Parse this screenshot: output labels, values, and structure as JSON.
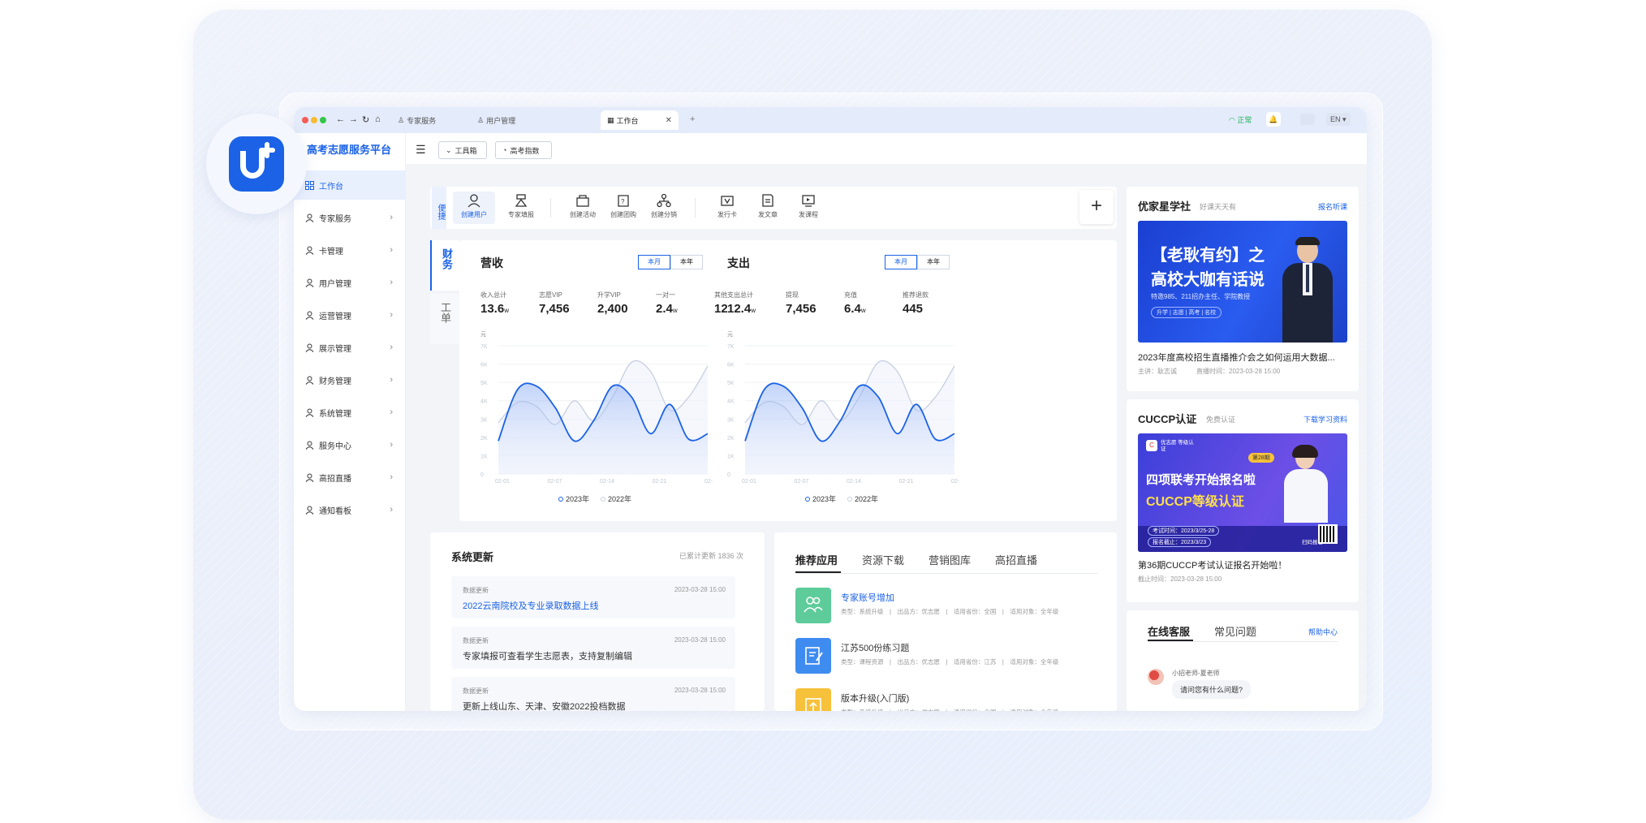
{
  "browser": {
    "tabs": [
      "专家服务",
      "用户管理",
      "工作台"
    ],
    "new_tab": "+",
    "status": "正常",
    "lang": "EN"
  },
  "sidebar": {
    "brand": "高考志愿服务平台",
    "items": [
      {
        "label": "工作台",
        "icon": "grid-icon"
      },
      {
        "label": "专家服务",
        "icon": "user-icon"
      },
      {
        "label": "卡管理",
        "icon": "user-icon"
      },
      {
        "label": "用户管理",
        "icon": "user-icon"
      },
      {
        "label": "运营管理",
        "icon": "user-icon"
      },
      {
        "label": "展示管理",
        "icon": "user-icon"
      },
      {
        "label": "财务管理",
        "icon": "user-icon"
      },
      {
        "label": "系统管理",
        "icon": "user-icon"
      },
      {
        "label": "服务中心",
        "icon": "user-icon"
      },
      {
        "label": "高招直播",
        "icon": "user-icon"
      },
      {
        "label": "通知看板",
        "icon": "user-icon"
      }
    ]
  },
  "topbar": {
    "toolbox": "工具箱",
    "gaokao_index": "高考指数"
  },
  "quick": {
    "label": "便捷",
    "items": [
      "创建用户",
      "专家填报",
      "创建活动",
      "创建团购",
      "创建分销",
      "发行卡",
      "发文章",
      "发课程"
    ]
  },
  "finance_tabs": [
    "财务",
    "工单"
  ],
  "revenue": {
    "title": "营收",
    "seg_month": "本月",
    "seg_year": "本年",
    "stats": [
      {
        "label": "收入总计",
        "value": "13.6",
        "unit": "w"
      },
      {
        "label": "志愿VIP",
        "value": "7,456",
        "unit": ""
      },
      {
        "label": "升学VIP",
        "value": "2,400",
        "unit": ""
      },
      {
        "label": "一对一",
        "value": "2.4",
        "unit": "w"
      },
      {
        "label": "其他",
        "value": "12",
        "unit": ""
      }
    ]
  },
  "expense": {
    "title": "支出",
    "seg_month": "本月",
    "seg_year": "本年",
    "stats": [
      {
        "label": "支出总计",
        "value": "12.4",
        "unit": "w"
      },
      {
        "label": "提现",
        "value": "7,456",
        "unit": ""
      },
      {
        "label": "充值",
        "value": "6.4",
        "unit": "w"
      },
      {
        "label": "推荐退款",
        "value": "445",
        "unit": ""
      }
    ]
  },
  "chart_data": [
    {
      "type": "line",
      "ylabel": "元",
      "yticks": [
        "7K",
        "6K",
        "5K",
        "4K",
        "3K",
        "2K",
        "1K",
        "0"
      ],
      "ylim": [
        0,
        7000
      ],
      "xticks": [
        "02-01",
        "02-07",
        "02-14",
        "02-21",
        "02-28"
      ],
      "series": [
        {
          "name": "2023年",
          "values": [
            1800,
            4600,
            4800,
            3600,
            1800,
            2900,
            4800,
            4200,
            2200,
            3800,
            1900,
            2200
          ]
        },
        {
          "name": "2022年",
          "values": [
            2800,
            3900,
            3700,
            2700,
            4000,
            2900,
            4200,
            6100,
            5600,
            3500,
            4200,
            5900
          ]
        }
      ],
      "grid": true
    },
    {
      "type": "line",
      "ylabel": "元",
      "yticks": [
        "7K",
        "6K",
        "5K",
        "4K",
        "3K",
        "2K",
        "1K",
        "0"
      ],
      "ylim": [
        0,
        7000
      ],
      "xticks": [
        "02-01",
        "02-07",
        "02-14",
        "02-21",
        "02-28"
      ],
      "series": [
        {
          "name": "2023年",
          "values": [
            1800,
            4600,
            4800,
            3600,
            1800,
            2900,
            4800,
            4200,
            2200,
            3800,
            1900,
            2200
          ]
        },
        {
          "name": "2022年",
          "values": [
            2800,
            3900,
            3700,
            2700,
            4000,
            2900,
            4200,
            6100,
            5600,
            3500,
            4200,
            5900
          ]
        }
      ],
      "grid": true
    }
  ],
  "updates": {
    "title": "系统更新",
    "count_text": "已累计更新 1836 次",
    "items": [
      {
        "category": "数据更新",
        "date": "2023-03-28 15:00",
        "title": "2022云南院校及专业录取数据上线",
        "highlight": true
      },
      {
        "category": "数据更新",
        "date": "2023-03-28 15:00",
        "title": "专家填报可查看学生志愿表，支持复制编辑",
        "highlight": false
      },
      {
        "category": "数据更新",
        "date": "2023-03-28 15:00",
        "title": "更新上线山东、天津、安徽2022投档数据",
        "highlight": false
      }
    ]
  },
  "apps": {
    "tabs": [
      "推荐应用",
      "资源下载",
      "营销图库",
      "高招直播"
    ],
    "items": [
      {
        "title": "专家账号增加",
        "meta": "类型：系统升级　|　出品方：优志愿　|　适用省份：全国　|　适用对象：全年级",
        "color": "#5dcc9a",
        "highlight": true
      },
      {
        "title": "江苏500份练习题",
        "meta": "类型：课程资源　|　出品方：优志愿　|　适用省份：江苏　|　适用对象：全年级",
        "color": "#3f8cf0",
        "highlight": false
      },
      {
        "title": "版本升级(入门版)",
        "meta": "类型：系统升级　|　出品方：优志愿　|　适用省份：全国　|　适用对象：全年级",
        "color": "#f7c23b",
        "highlight": false
      }
    ]
  },
  "promo1": {
    "title": "优家星学社",
    "sub": "好课天天有",
    "link": "报名听课",
    "banner_line1": "【老耿有约】之",
    "banner_line2": "高校大咖有话说",
    "banner_line3": "特邀985、211招办主任、学院教授",
    "banner_tags": "升学 | 志愿 | 高考 | 名校",
    "caption": "2023年度高校招生直播推介会之如何运用大数据...",
    "meta_host": "主讲：耿志诚",
    "meta_time": "直播时间：2023-03-28 15:00"
  },
  "promo2": {
    "title": "CUCCP认证",
    "sub": "免费认证",
    "link": "下载学习资料",
    "banner_badge": "第28期",
    "banner_brand": "优志愿 等级认证",
    "banner_line1": "四项联考开始报名啦",
    "banner_line2": "CUCCP等级认证",
    "exam_time": "考试时间：2023/3/25-28",
    "deadline": "报名截止：2023/3/23",
    "scan": "扫码报名",
    "caption": "第36期CUCCP考试认证报名开始啦！",
    "meta": "截止时间：2023-03-28 15:00"
  },
  "support": {
    "tabs": [
      "在线客服",
      "常见问题"
    ],
    "help": "帮助中心",
    "agent": "小招老师-夏老师",
    "message": "请问您有什么问题?"
  },
  "colors": {
    "accent": "#1b62e6",
    "series_2022": "#c7cfe0"
  }
}
